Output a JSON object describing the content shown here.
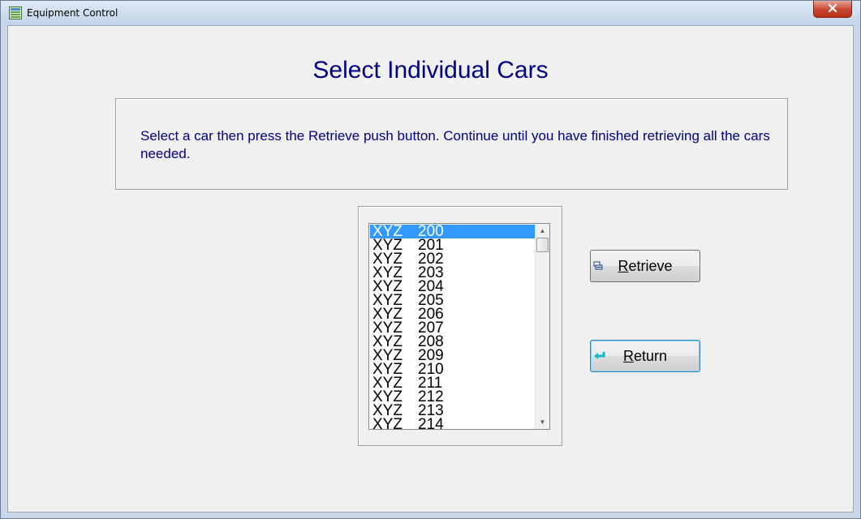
{
  "window": {
    "title": "Equipment Control"
  },
  "page": {
    "heading": "Select Individual Cars",
    "instructions": "Select a car then press the Retrieve push button.  Continue until you have finished retrieving all the cars needed."
  },
  "car_list": {
    "selected_index": 0,
    "items": [
      {
        "prefix": "XYZ",
        "number": "200"
      },
      {
        "prefix": "XYZ",
        "number": "201"
      },
      {
        "prefix": "XYZ",
        "number": "202"
      },
      {
        "prefix": "XYZ",
        "number": "203"
      },
      {
        "prefix": "XYZ",
        "number": "204"
      },
      {
        "prefix": "XYZ",
        "number": "205"
      },
      {
        "prefix": "XYZ",
        "number": "206"
      },
      {
        "prefix": "XYZ",
        "number": "207"
      },
      {
        "prefix": "XYZ",
        "number": "208"
      },
      {
        "prefix": "XYZ",
        "number": "209"
      },
      {
        "prefix": "XYZ",
        "number": "210"
      },
      {
        "prefix": "XYZ",
        "number": "211"
      },
      {
        "prefix": "XYZ",
        "number": "212"
      },
      {
        "prefix": "XYZ",
        "number": "213"
      },
      {
        "prefix": "XYZ",
        "number": "214"
      }
    ]
  },
  "buttons": {
    "retrieve": {
      "mnemonic": "R",
      "rest": "etrieve",
      "icon": "retrieve-icon"
    },
    "return": {
      "mnemonic": "R",
      "rest": "eturn",
      "icon": "return-arrow-icon"
    }
  },
  "colors": {
    "heading": "#000080",
    "selection": "#3399ff",
    "close_button": "#c9452f"
  }
}
